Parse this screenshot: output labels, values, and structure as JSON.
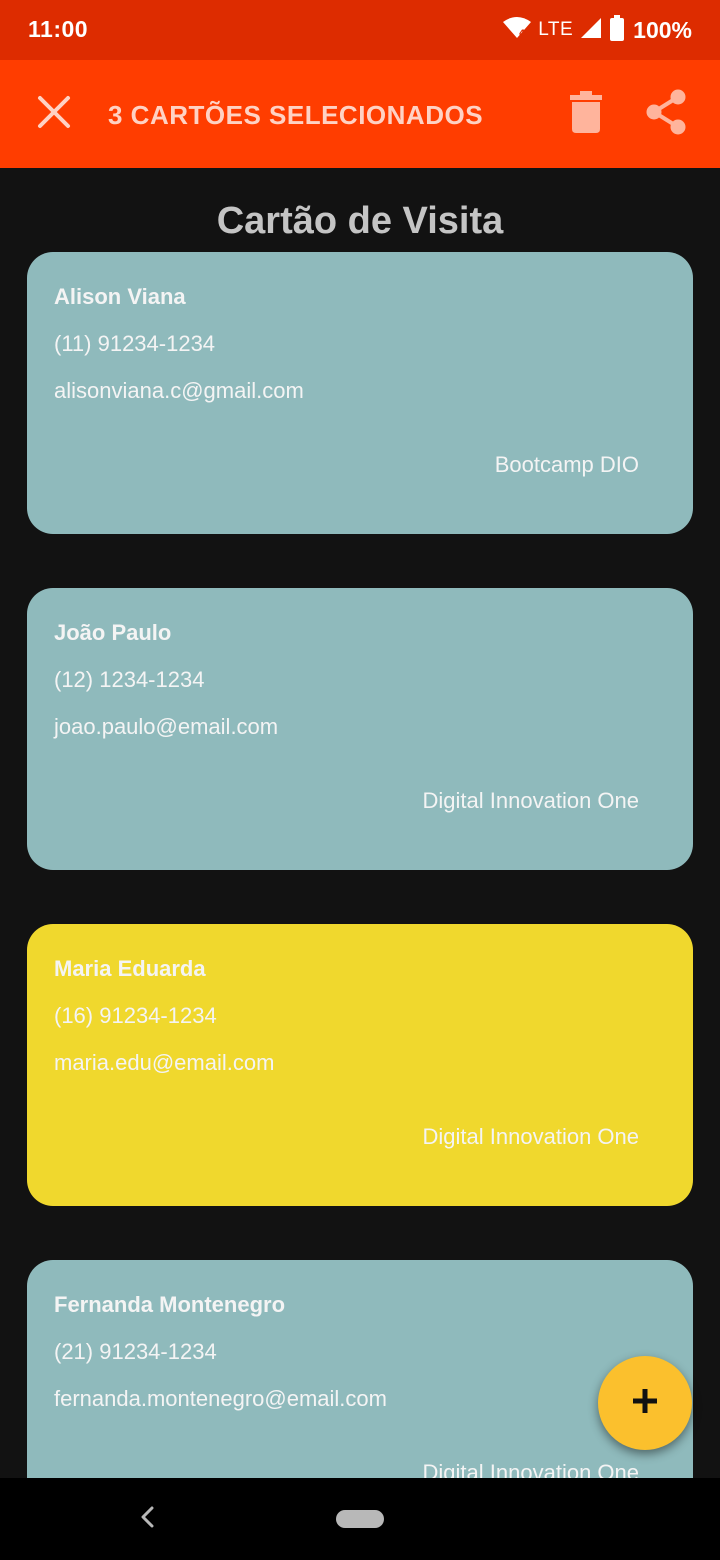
{
  "status_bar": {
    "time": "11:00",
    "network": "LTE",
    "battery": "100%",
    "icons": [
      "wifi-icon",
      "signal-icon",
      "battery-icon"
    ]
  },
  "action_bar": {
    "title": "3 CARTÕES SELECIONADOS",
    "icons": [
      "close-icon",
      "delete-icon",
      "share-icon"
    ],
    "background": "#ff3d00"
  },
  "page": {
    "title": "Cartão de Visita"
  },
  "cards": [
    {
      "name": "Alison Viana",
      "phone": "(11) 91234-1234",
      "email": "alisonviana.c@gmail.com",
      "company": "Bootcamp DIO",
      "color": "#8fbabc"
    },
    {
      "name": "João Paulo",
      "phone": "(12) 1234-1234",
      "email": "joao.paulo@email.com",
      "company": "Digital Innovation One",
      "color": "#8fbabc"
    },
    {
      "name": "Maria Eduarda",
      "phone": "(16) 91234-1234",
      "email": "maria.edu@email.com",
      "company": "Digital Innovation One",
      "color": "#f0d82d"
    },
    {
      "name": "Fernanda Montenegro",
      "phone": "(21) 91234-1234",
      "email": "fernanda.montenegro@email.com",
      "company": "Digital Innovation One",
      "color": "#8fbabc"
    }
  ],
  "fab": {
    "icon": "plus-icon",
    "color": "#fbc02d"
  },
  "nav_bar": {
    "icons": [
      "back-icon",
      "home-pill"
    ]
  }
}
